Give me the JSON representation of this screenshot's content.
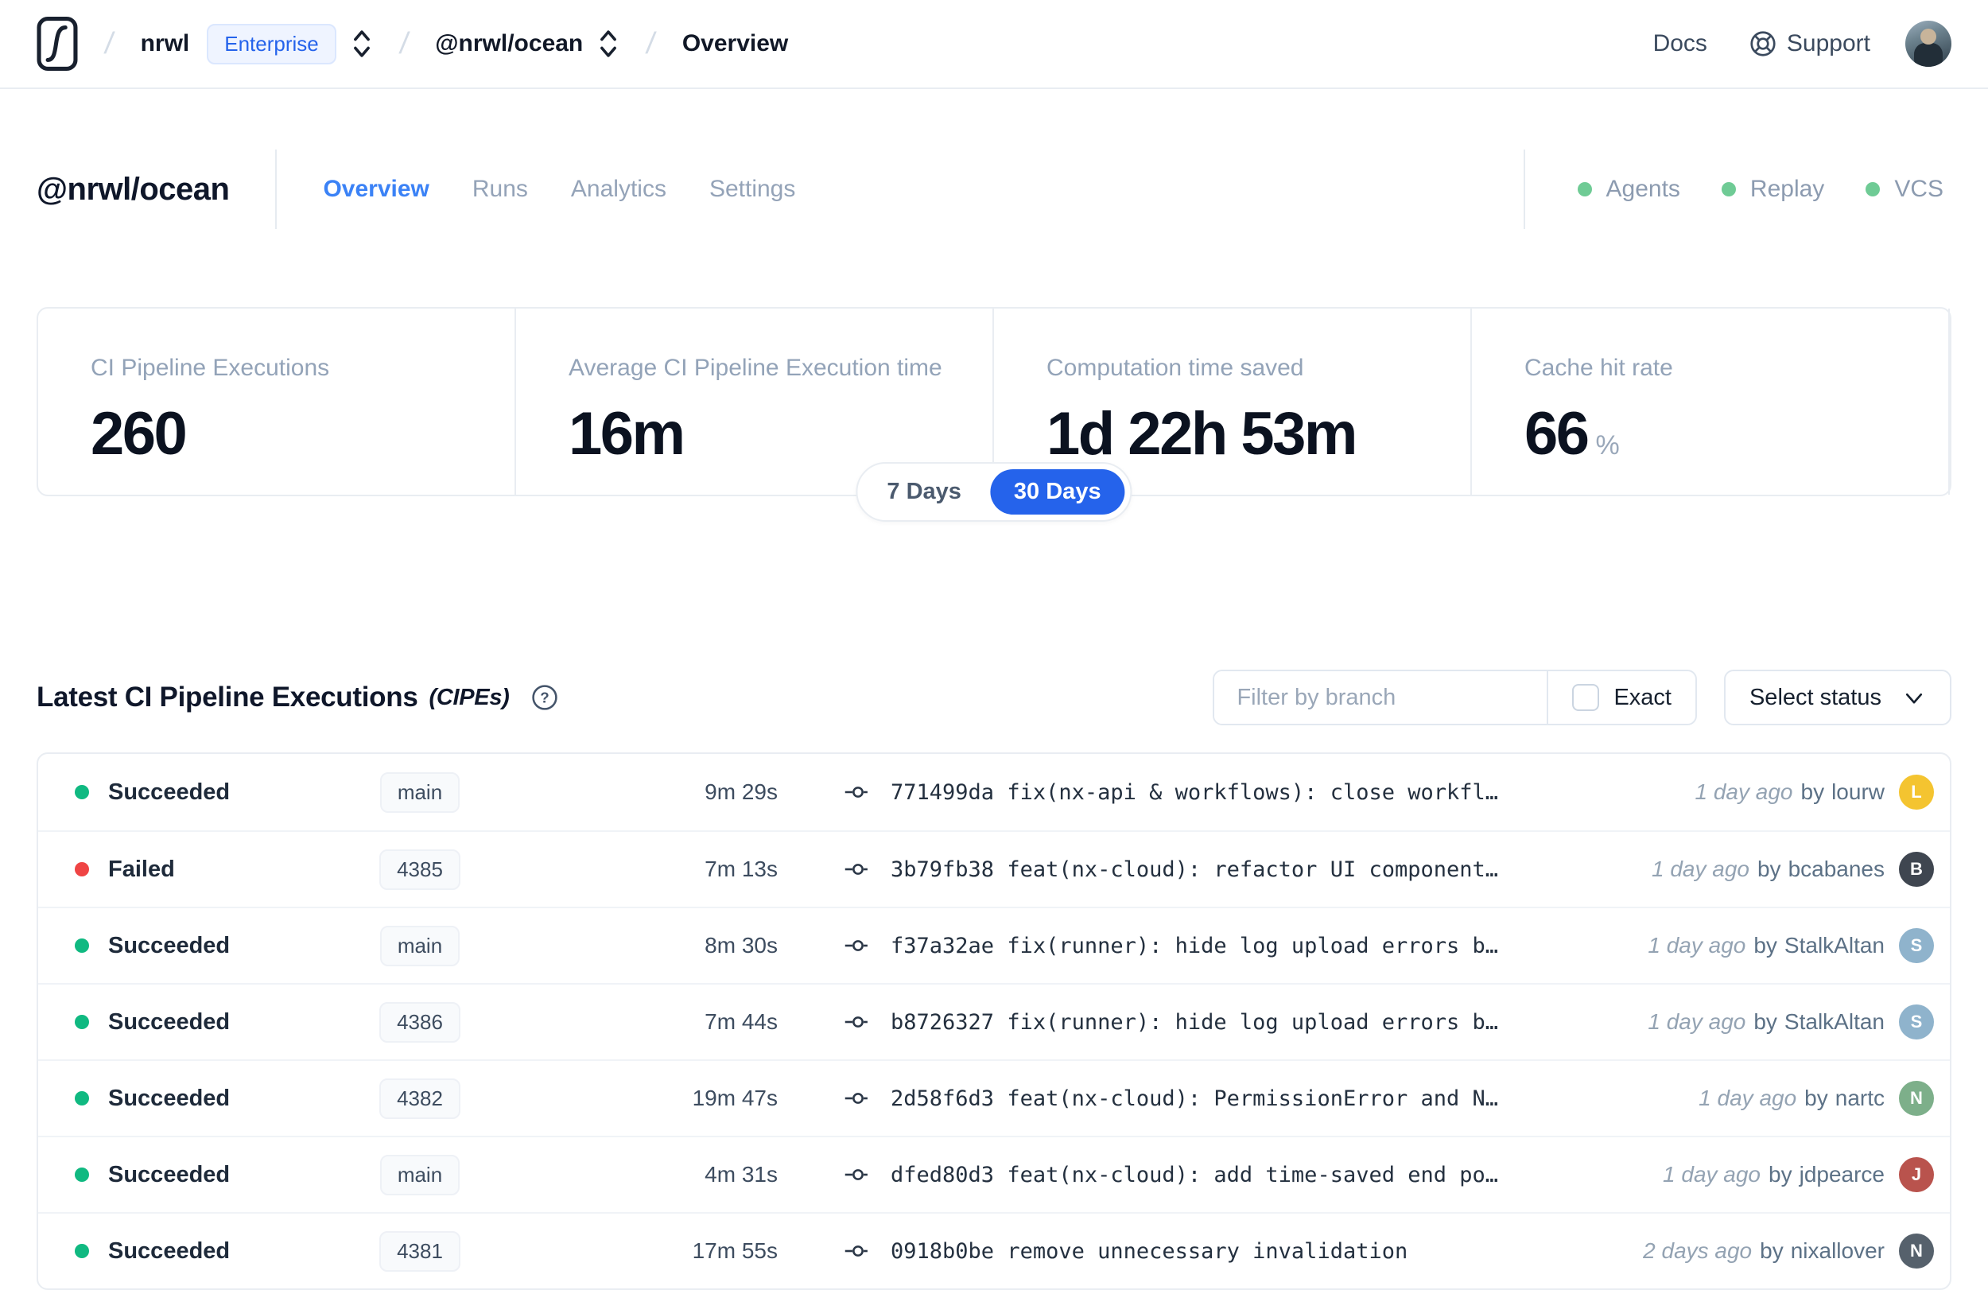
{
  "nav": {
    "separator": "/",
    "org": "nrwl",
    "org_badge": "Enterprise",
    "workspace": "@nrwl/ocean",
    "page": "Overview",
    "docs_label": "Docs",
    "support_label": "Support"
  },
  "header": {
    "workspace": "@nrwl/ocean",
    "tabs": [
      {
        "label": "Overview",
        "active": true
      },
      {
        "label": "Runs",
        "active": false
      },
      {
        "label": "Analytics",
        "active": false
      },
      {
        "label": "Settings",
        "active": false
      }
    ],
    "services": [
      {
        "label": "Agents",
        "status_color": "#6fcb95"
      },
      {
        "label": "Replay",
        "status_color": "#6fcb95"
      },
      {
        "label": "VCS",
        "status_color": "#6fcb95"
      }
    ]
  },
  "stats": [
    {
      "label": "CI Pipeline Executions",
      "value": "260",
      "suffix": ""
    },
    {
      "label": "Average CI Pipeline Execution time",
      "value": "16m",
      "suffix": ""
    },
    {
      "label": "Computation time saved",
      "value": "1d 22h 53m",
      "suffix": ""
    },
    {
      "label": "Cache hit rate",
      "value": "66",
      "suffix": "%"
    }
  ],
  "range_toggle": {
    "options": [
      "7 Days",
      "30 Days"
    ],
    "selected": "30 Days",
    "selected_color": "#2563eb"
  },
  "section": {
    "title": "Latest CI Pipeline Executions",
    "subtitle": "(CIPEs)",
    "help_glyph": "?"
  },
  "filters": {
    "branch_placeholder": "Filter by branch",
    "exact_label": "Exact",
    "exact_checked": false,
    "status_label": "Select status"
  },
  "table": {
    "by_label": "by",
    "status_colors": {
      "succeeded": "#10b981",
      "failed": "#ef4444"
    },
    "rows": [
      {
        "status": "Succeeded",
        "status_color": "#10b981",
        "branch": "main",
        "duration": "9m 29s",
        "commit_hash": "771499da",
        "commit_message": "fix(nx-api & workflows): close workfl…",
        "time_ago": "1 day ago",
        "author": "lourw",
        "avatar_initial": "L",
        "avatar_color": "#f4c430"
      },
      {
        "status": "Failed",
        "status_color": "#ef4444",
        "branch": "4385",
        "duration": "7m 13s",
        "commit_hash": "3b79fb38",
        "commit_message": "feat(nx-cloud): refactor UI component…",
        "time_ago": "1 day ago",
        "author": "bcabanes",
        "avatar_initial": "B",
        "avatar_color": "#3f4650"
      },
      {
        "status": "Succeeded",
        "status_color": "#10b981",
        "branch": "main",
        "duration": "8m 30s",
        "commit_hash": "f37a32ae",
        "commit_message": "fix(runner): hide log upload errors b…",
        "time_ago": "1 day ago",
        "author": "StalkAltan",
        "avatar_initial": "S",
        "avatar_color": "#8fb3cc"
      },
      {
        "status": "Succeeded",
        "status_color": "#10b981",
        "branch": "4386",
        "duration": "7m 44s",
        "commit_hash": "b8726327",
        "commit_message": "fix(runner): hide log upload errors b…",
        "time_ago": "1 day ago",
        "author": "StalkAltan",
        "avatar_initial": "S",
        "avatar_color": "#8fb3cc"
      },
      {
        "status": "Succeeded",
        "status_color": "#10b981",
        "branch": "4382",
        "duration": "19m 47s",
        "commit_hash": "2d58f6d3",
        "commit_message": "feat(nx-cloud): PermissionError and N…",
        "time_ago": "1 day ago",
        "author": "nartc",
        "avatar_initial": "N",
        "avatar_color": "#7daf8a"
      },
      {
        "status": "Succeeded",
        "status_color": "#10b981",
        "branch": "main",
        "duration": "4m 31s",
        "commit_hash": "dfed80d3",
        "commit_message": "feat(nx-cloud): add time-saved end po…",
        "time_ago": "1 day ago",
        "author": "jdpearce",
        "avatar_initial": "J",
        "avatar_color": "#b9534d"
      },
      {
        "status": "Succeeded",
        "status_color": "#10b981",
        "branch": "4381",
        "duration": "17m 55s",
        "commit_hash": "0918b0be",
        "commit_message": "remove unnecessary invalidation",
        "time_ago": "2 days ago",
        "author": "nixallover",
        "avatar_initial": "N",
        "avatar_color": "#56616c"
      }
    ]
  }
}
